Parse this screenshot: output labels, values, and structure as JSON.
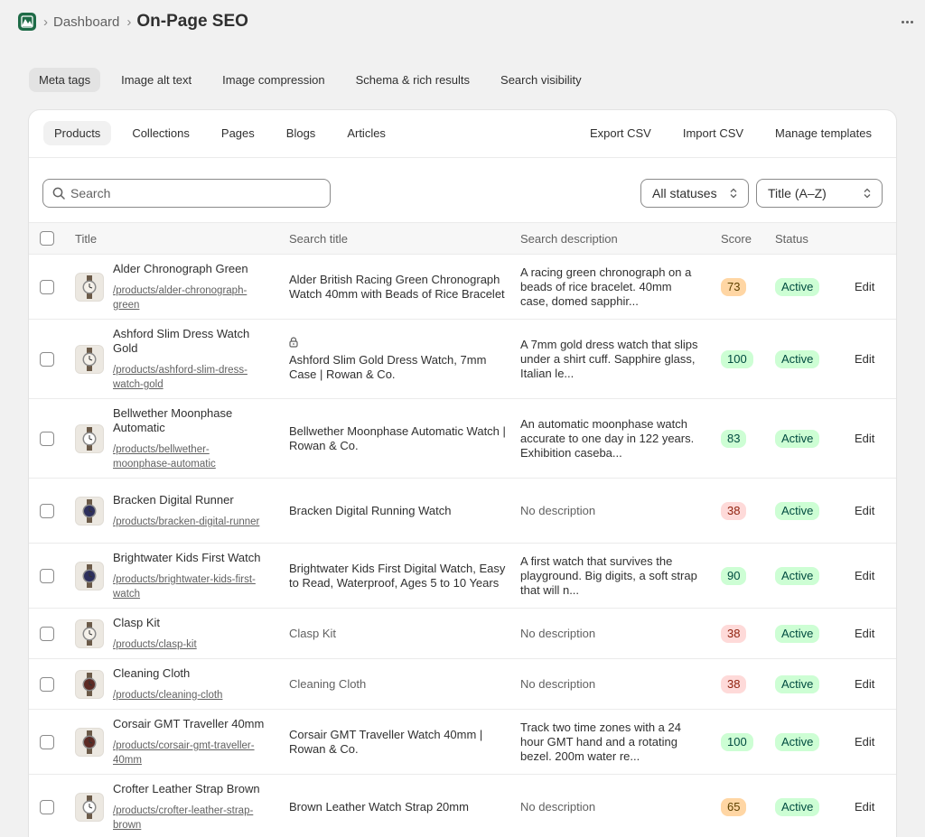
{
  "breadcrumb": {
    "parent": "Dashboard",
    "title": "On-Page SEO"
  },
  "top_tabs": [
    "Meta tags",
    "Image alt text",
    "Image compression",
    "Schema & rich results",
    "Search visibility"
  ],
  "sub_tabs": [
    "Products",
    "Collections",
    "Pages",
    "Blogs",
    "Articles"
  ],
  "actions": [
    "Export CSV",
    "Import CSV",
    "Manage templates"
  ],
  "search": {
    "placeholder": "Search",
    "value": ""
  },
  "filters": {
    "status": "All statuses",
    "sort": "Title (A–Z)"
  },
  "columns": {
    "title": "Title",
    "search_title": "Search title",
    "search_description": "Search description",
    "score": "Score",
    "status": "Status"
  },
  "colors": {
    "score_high_bg": "#cdfed4",
    "score_high_fg": "#014b40",
    "score_mid_bg": "#ffd6a4",
    "score_mid_fg": "#5e4200",
    "score_low_bg": "#fedad9",
    "score_low_fg": "#8e1f0b",
    "active_bg": "#cdfed4",
    "active_fg": "#014b40"
  },
  "rows": [
    {
      "name": "Alder Chronograph Green",
      "handle": "/products/alder-chronograph-green",
      "search_title": "Alder British Racing Green Chronograph Watch 40mm with Beads of Rice Bracelet",
      "search_description": "A racing green chronograph on a beads of rice bracelet. 40mm case, domed sapphir...",
      "score": "73",
      "score_level": "mid",
      "status": "Active",
      "edit": "Edit",
      "locked": false,
      "title_muted": false,
      "desc_muted": false,
      "dial": "#f5f1ea"
    },
    {
      "name": "Ashford Slim Dress Watch Gold",
      "handle": "/products/ashford-slim-dress-watch-gold",
      "search_title": "Ashford Slim Gold Dress Watch, 7mm Case | Rowan & Co.",
      "search_description": "A 7mm gold dress watch that slips under a shirt cuff. Sapphire glass, Italian le...",
      "score": "100",
      "score_level": "high",
      "status": "Active",
      "edit": "Edit",
      "locked": true,
      "title_muted": false,
      "desc_muted": false,
      "dial": "#f5f1ea"
    },
    {
      "name": "Bellwether Moonphase Automatic",
      "handle": "/products/bellwether-moonphase-automatic",
      "search_title": "Bellwether Moonphase Automatic Watch | Rowan & Co.",
      "search_description": "An automatic moonphase watch accurate to one day in 122 years. Exhibition caseba...",
      "score": "83",
      "score_level": "high",
      "status": "Active",
      "edit": "Edit",
      "locked": false,
      "title_muted": false,
      "desc_muted": false,
      "dial": "#ffffff"
    },
    {
      "name": "Bracken Digital Runner",
      "handle": "/products/bracken-digital-runner",
      "search_title": "Bracken Digital Running Watch",
      "search_description": "No description",
      "score": "38",
      "score_level": "low",
      "status": "Active",
      "edit": "Edit",
      "locked": false,
      "title_muted": false,
      "desc_muted": true,
      "dial": "#2d2f5c"
    },
    {
      "name": "Brightwater Kids First Watch",
      "handle": "/products/brightwater-kids-first-watch",
      "search_title": "Brightwater Kids First Digital Watch, Easy to Read, Waterproof, Ages 5 to 10 Years",
      "search_description": "A first watch that survives the playground. Big digits, a soft strap that will n...",
      "score": "90",
      "score_level": "high",
      "status": "Active",
      "edit": "Edit",
      "locked": false,
      "title_muted": false,
      "desc_muted": false,
      "dial": "#2d2f5c"
    },
    {
      "name": "Clasp Kit",
      "handle": "/products/clasp-kit",
      "search_title": "Clasp Kit",
      "search_description": "No description",
      "score": "38",
      "score_level": "low",
      "status": "Active",
      "edit": "Edit",
      "locked": false,
      "title_muted": true,
      "desc_muted": true,
      "dial": "#f5f1ea"
    },
    {
      "name": "Cleaning Cloth",
      "handle": "/products/cleaning-cloth",
      "search_title": "Cleaning Cloth",
      "search_description": "No description",
      "score": "38",
      "score_level": "low",
      "status": "Active",
      "edit": "Edit",
      "locked": false,
      "title_muted": true,
      "desc_muted": true,
      "dial": "#5c2a24"
    },
    {
      "name": "Corsair GMT Traveller 40mm",
      "handle": "/products/corsair-gmt-traveller-40mm",
      "search_title": "Corsair GMT Traveller Watch 40mm | Rowan & Co.",
      "search_description": "Track two time zones with a 24 hour GMT hand and a rotating bezel. 200m water re...",
      "score": "100",
      "score_level": "high",
      "status": "Active",
      "edit": "Edit",
      "locked": false,
      "title_muted": false,
      "desc_muted": false,
      "dial": "#5c2a24"
    },
    {
      "name": "Crofter Leather Strap Brown",
      "handle": "/products/crofter-leather-strap-brown",
      "search_title": "Brown Leather Watch Strap 20mm",
      "search_description": "No description",
      "score": "65",
      "score_level": "mid",
      "status": "Active",
      "edit": "Edit",
      "locked": false,
      "title_muted": false,
      "desc_muted": true,
      "dial": "#ffffff"
    }
  ]
}
